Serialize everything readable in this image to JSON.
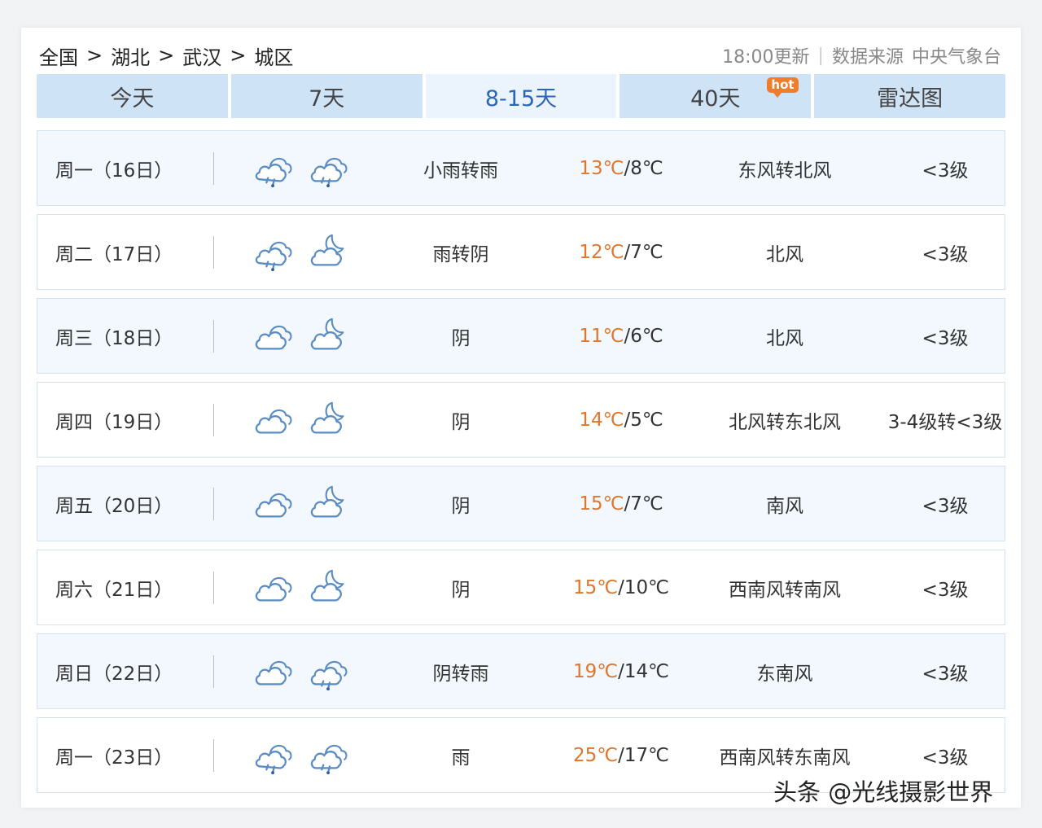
{
  "breadcrumb": [
    "全国",
    "湖北",
    "武汉",
    "城区"
  ],
  "breadcrumb_sep": ">",
  "meta": {
    "updated": "18:00更新",
    "divider": "|",
    "source_label": "数据来源",
    "source": "中央气象台"
  },
  "tabs": [
    {
      "label": "今天",
      "active": false
    },
    {
      "label": "7天",
      "active": false
    },
    {
      "label": "8-15天",
      "active": true
    },
    {
      "label": "40天",
      "active": false,
      "badge": "hot"
    },
    {
      "label": "雷达图",
      "active": false
    }
  ],
  "colors": {
    "accent": "#2a66b5",
    "high_temp": "#e0762b",
    "tab_bg": "#cfe3f7",
    "row_alt": "#f2f8fd",
    "hot_badge": "#ef7d2a"
  },
  "forecast": [
    {
      "day": "周一（16日）",
      "icons": [
        "rain-icon",
        "night-rain-icon"
      ],
      "desc": "小雨转雨",
      "high": "13℃",
      "low": "8℃",
      "wind": "东风转北风",
      "level": "<3级"
    },
    {
      "day": "周二（17日）",
      "icons": [
        "rain-icon",
        "cloudy-night-icon"
      ],
      "desc": "雨转阴",
      "high": "12℃",
      "low": "7℃",
      "wind": "北风",
      "level": "<3级"
    },
    {
      "day": "周三（18日）",
      "icons": [
        "overcast-icon",
        "cloudy-night-icon"
      ],
      "desc": "阴",
      "high": "11℃",
      "low": "6℃",
      "wind": "北风",
      "level": "<3级"
    },
    {
      "day": "周四（19日）",
      "icons": [
        "overcast-icon",
        "cloudy-night-icon"
      ],
      "desc": "阴",
      "high": "14℃",
      "low": "5℃",
      "wind": "北风转东北风",
      "level": "3-4级转<3级"
    },
    {
      "day": "周五（20日）",
      "icons": [
        "overcast-icon",
        "cloudy-night-icon"
      ],
      "desc": "阴",
      "high": "15℃",
      "low": "7℃",
      "wind": "南风",
      "level": "<3级"
    },
    {
      "day": "周六（21日）",
      "icons": [
        "overcast-icon",
        "cloudy-night-icon"
      ],
      "desc": "阴",
      "high": "15℃",
      "low": "10℃",
      "wind": "西南风转南风",
      "level": "<3级"
    },
    {
      "day": "周日（22日）",
      "icons": [
        "overcast-icon",
        "night-rain-icon"
      ],
      "desc": "阴转雨",
      "high": "19℃",
      "low": "14℃",
      "wind": "东南风",
      "level": "<3级"
    },
    {
      "day": "周一（23日）",
      "icons": [
        "rain-icon",
        "night-rain-icon"
      ],
      "desc": "雨",
      "high": "25℃",
      "low": "17℃",
      "wind": "西南风转东南风",
      "level": "<3级"
    }
  ],
  "temp_sep": "/",
  "watermark": "头条 @光线摄影世界"
}
